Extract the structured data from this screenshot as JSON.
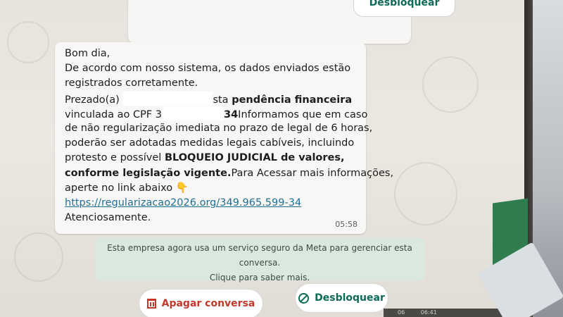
{
  "top_bubble": {
    "unblock_label": "Desbloquear"
  },
  "message": {
    "lines": [
      "Bom dia,",
      "De acordo com nosso sistema, os dados enviados estão",
      "registrados corretamente.",
      "Prezado(a)",
      "sta",
      "pendência financeira",
      "vinculada ao CPF 3",
      "34",
      "Informamos que em caso",
      "de não regularização imediata no prazo de legal de 6 horas,",
      "poderão ser adotadas medidas legais cabíveis, incluindo",
      "protesto e possível ",
      "BLOQUEIO JUDICIAL de valores,",
      "conforme legislação vigente.",
      "Para Acessar mais informações,",
      "aperte no link abaixo",
      "👇",
      "https://regularizacao2026.org/349.965.599-34",
      "Atenciosamente."
    ],
    "time": "05:58"
  },
  "notice": {
    "line1": "Esta empresa agora usa um serviço seguro da Meta para gerenciar esta conversa.",
    "line2": "Clique para saber mais."
  },
  "actions": {
    "delete_label": "Apagar conversa",
    "unblock_label": "Desbloquear"
  },
  "taskbar": {
    "left": "06",
    "time": "06:41"
  },
  "icons": {
    "delete": "trash-icon",
    "unblock": "block-icon"
  },
  "colors": {
    "danger": "#c1392b",
    "accent": "#0b6b56",
    "link": "#1f6f96",
    "notice_bg": "#dbe8df"
  }
}
